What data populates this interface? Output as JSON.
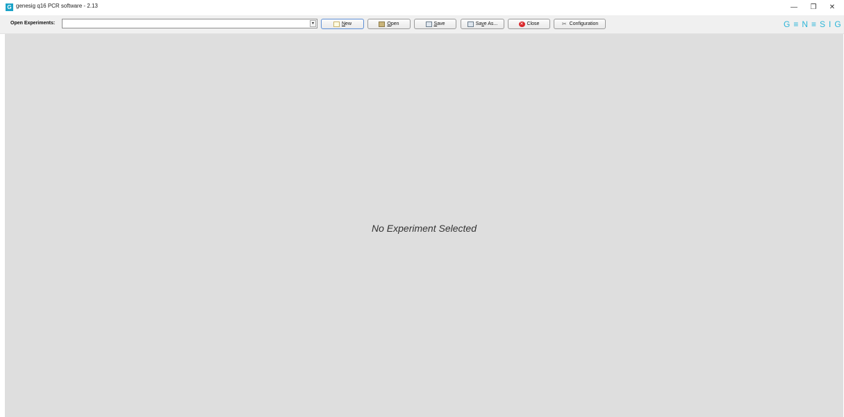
{
  "window": {
    "title": "genesig q16 PCR software - 2.13",
    "app_icon_letter": "G",
    "controls": {
      "minimize": "—",
      "maximize": "❐",
      "close": "✕"
    }
  },
  "toolbar": {
    "open_experiments_label": "Open Experiments:",
    "experiments_combo_value": "",
    "combo_arrow": "▾",
    "buttons": {
      "new": {
        "label_underlined": "N",
        "label_rest": "ew",
        "icon": "new-document-icon"
      },
      "open": {
        "label_underlined": "O",
        "label_rest": "pen",
        "icon": "folder-icon"
      },
      "save": {
        "label_underlined": "S",
        "label_rest": "ave",
        "icon": "floppy-disk-icon"
      },
      "save_as": {
        "label_start": "Sa",
        "label_underlined": "v",
        "label_rest": "e As...",
        "icon": "floppy-disk-icon"
      },
      "close": {
        "label": "Close",
        "icon": "close-circle-icon",
        "glyph": "✕"
      },
      "configuration": {
        "label": "Configuration",
        "icon": "tools-icon",
        "glyph": "✂"
      }
    },
    "brand": "G≡N≡SIG"
  },
  "main": {
    "placeholder_text": "No Experiment Selected"
  },
  "colors": {
    "brand": "#2cb5d8",
    "content_background": "#dedede",
    "toolbar_background": "#f0f0f0"
  }
}
